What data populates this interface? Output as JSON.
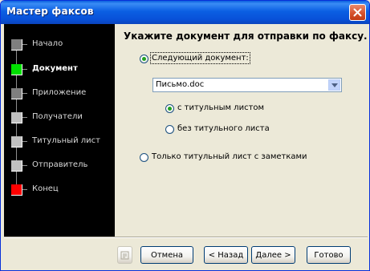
{
  "window": {
    "title": "Мастер факсов"
  },
  "sidebar": {
    "steps": [
      {
        "label": "Начало",
        "color": "#7f7f7f"
      },
      {
        "label": "Документ",
        "color": "#00e000",
        "active": true
      },
      {
        "label": "Приложение",
        "color": "#7f7f7f"
      },
      {
        "label": "Получатели",
        "color": "#c0c0c0"
      },
      {
        "label": "Титульный лист",
        "color": "#c0c0c0"
      },
      {
        "label": "Отправитель",
        "color": "#c0c0c0"
      },
      {
        "label": "Конец",
        "color": "#ff0000"
      }
    ]
  },
  "main": {
    "heading": "Укажите документ для отправки по факсу.",
    "option_document": "Следующий документ:",
    "document_select": "Письмо.doc",
    "option_with_cover": "с титульным листом",
    "option_without_cover": "без титульного листа",
    "option_cover_only": "Только титульный лист с заметками"
  },
  "footer": {
    "cancel": "Отмена",
    "back": "< Назад",
    "next": "Далее >",
    "finish": "Готово"
  }
}
